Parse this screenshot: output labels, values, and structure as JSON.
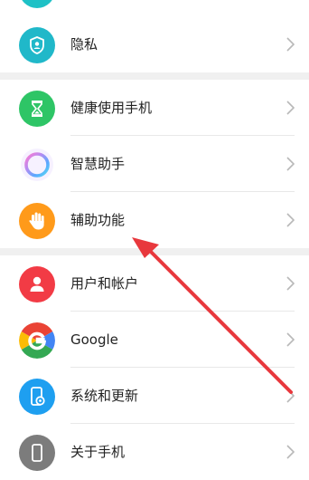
{
  "settings": {
    "items": [
      {
        "id": "top-partial",
        "label": "",
        "icon": "generic-icon",
        "color": "#1ec1c6"
      },
      {
        "id": "privacy",
        "label": "隐私",
        "icon": "shield-icon",
        "color": "#20b8c9"
      },
      {
        "id": "digital-balance",
        "label": "健康使用手机",
        "icon": "hourglass-icon",
        "color": "#2ec566"
      },
      {
        "id": "smart-assistant",
        "label": "智慧助手",
        "icon": "ring-icon",
        "color": "#b78bf1"
      },
      {
        "id": "accessibility",
        "label": "辅助功能",
        "icon": "hand-icon",
        "color": "#ff9a1a"
      },
      {
        "id": "users-accounts",
        "label": "用户和帐户",
        "icon": "person-icon",
        "color": "#f23b45"
      },
      {
        "id": "google",
        "label": "Google",
        "icon": "google-g-icon",
        "color": "#4285f4"
      },
      {
        "id": "system-update",
        "label": "系统和更新",
        "icon": "phone-gear-icon",
        "color": "#1e9ff0"
      },
      {
        "id": "about-phone",
        "label": "关于手机",
        "icon": "phone-icon",
        "color": "#7c7c7c"
      }
    ]
  },
  "annotation": {
    "icon": "red-arrow-icon",
    "color": "#e8383d",
    "points_to": "accessibility"
  },
  "colors": {
    "divider": "#e8e8e8",
    "section_gap": "#f0f0f0",
    "chevron": "#b8b8b8",
    "text": "#222222"
  }
}
